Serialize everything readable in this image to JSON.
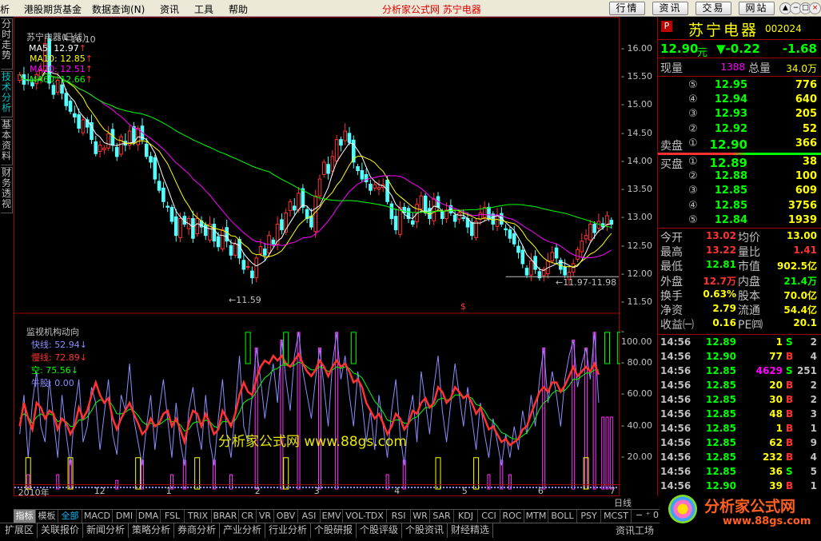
{
  "menu": {
    "items": [
      "析",
      "港股期货基金",
      "数据查询(N)",
      "资讯",
      "工具",
      "帮助"
    ],
    "title": "分析家公式网  苏宁电器",
    "buttons": [
      "行情",
      "资讯",
      "交易",
      "网站"
    ],
    "window_controls": [
      "▲",
      "−",
      "□",
      "×"
    ]
  },
  "side_tabs": [
    "分时走势",
    "技术分析",
    "基本资料",
    "财务透视"
  ],
  "price_panel": {
    "title": "苏宁电器(日线)",
    "mas": [
      {
        "label": "MA5: 12.97",
        "color": "#ffffff"
      },
      {
        "label": "MA10: 12.85",
        "color": "#ffff00"
      },
      {
        "label": "MA20: 12.51",
        "color": "#ff00ff"
      },
      {
        "label": "MA60: 12.66",
        "color": "#00ff00"
      }
    ],
    "ylim": [
      11.35,
      16.25
    ],
    "ticks": [
      {
        "value": 16.0,
        "label": "16.00"
      },
      {
        "value": 15.5,
        "label": "15.50"
      },
      {
        "value": 15.0,
        "label": "15.00"
      },
      {
        "value": 14.5,
        "label": "14.50"
      },
      {
        "value": 14.0,
        "label": "14.00"
      },
      {
        "value": 13.5,
        "label": "13.50"
      },
      {
        "value": 13.0,
        "label": "13.00"
      },
      {
        "value": 12.5,
        "label": "12.50"
      },
      {
        "value": 12.0,
        "label": "12.00"
      },
      {
        "value": 11.5,
        "label": "11.50"
      }
    ],
    "high_label": "16.10",
    "low_label": "11.59",
    "range_label": "11.97-11.98",
    "marker": "$",
    "up_color": "#ff3232",
    "down_color": "#54ffff"
  },
  "indicator_panel": {
    "title": "监视机构动向",
    "lines": [
      {
        "label": "快线: 52.94↓",
        "color": "#8c8cff"
      },
      {
        "label": "慢线: 72.89↓",
        "color": "#ff3232"
      },
      {
        "label": "空: 75.56↓",
        "color": "#00ff00"
      },
      {
        "label": "牛股: 0.00",
        "color": "#8c8cff"
      }
    ],
    "ylim": [
      0,
      105
    ],
    "ticks": [
      {
        "value": 100,
        "label": "100.00"
      },
      {
        "value": 80,
        "label": "80.00"
      },
      {
        "value": 60,
        "label": "60.00"
      },
      {
        "value": 40,
        "label": "40.00"
      },
      {
        "value": 20,
        "label": "20.00"
      }
    ],
    "watermark": "分析家公式网 www.88gs.com"
  },
  "xaxis": {
    "labels": [
      {
        "day": 0,
        "text": "2010年"
      },
      {
        "day": 18,
        "text": "12"
      },
      {
        "day": 35,
        "text": "1"
      },
      {
        "day": 56,
        "text": "2"
      },
      {
        "day": 70,
        "text": "3"
      },
      {
        "day": 89,
        "text": "4"
      },
      {
        "day": 105,
        "text": "5"
      },
      {
        "day": 123,
        "text": "6"
      },
      {
        "day": 140,
        "text": "7"
      }
    ],
    "period": "日线"
  },
  "chart_data": {
    "type": "candlestick",
    "ohlc_close": [
      15.55,
      15.38,
      15.45,
      15.35,
      15.55,
      15.62,
      16.1,
      15.4,
      15.2,
      15.45,
      15.22,
      15.0,
      14.9,
      14.8,
      14.6,
      14.75,
      14.62,
      14.4,
      14.15,
      14.3,
      14.25,
      14.5,
      14.3,
      14.1,
      14.45,
      14.3,
      14.55,
      14.35,
      14.6,
      14.4,
      14.1,
      14.0,
      13.7,
      13.5,
      13.3,
      13.2,
      12.95,
      12.7,
      13.0,
      12.9,
      13.0,
      12.65,
      13.0,
      12.85,
      12.7,
      12.9,
      12.6,
      12.5,
      12.8,
      12.6,
      12.35,
      12.55,
      12.3,
      12.1,
      12.15,
      11.95,
      12.3,
      12.5,
      12.35,
      12.7,
      12.55,
      12.9,
      12.8,
      13.1,
      13.3,
      13.15,
      13.45,
      13.2,
      13.0,
      12.85,
      13.4,
      13.7,
      14.0,
      13.8,
      14.1,
      14.4,
      14.3,
      14.55,
      14.35,
      14.0,
      13.85,
      13.7,
      13.65,
      13.5,
      13.6,
      13.55,
      13.6,
      13.3,
      13.0,
      12.8,
      13.2,
      13.1,
      13.0,
      12.9,
      13.25,
      13.4,
      13.1,
      13.0,
      13.35,
      13.2,
      13.0,
      13.15,
      13.1,
      12.95,
      13.1,
      13.0,
      12.85,
      12.7,
      12.95,
      13.1,
      13.2,
      13.0,
      12.9,
      13.05,
      12.9,
      12.8,
      12.65,
      12.55,
      12.4,
      12.2,
      12.0,
      12.25,
      12.1,
      11.95,
      12.1,
      12.25,
      12.4,
      12.3,
      12.1,
      12.0,
      12.05,
      12.2,
      12.45,
      12.6,
      12.7,
      12.9,
      12.75,
      12.95,
      12.85,
      13.05,
      12.9
    ],
    "kdj": {
      "fast": [
        35,
        60,
        20,
        55,
        75,
        40,
        30,
        70,
        45,
        20,
        60,
        35,
        15,
        50,
        70,
        30,
        40,
        65,
        55,
        25,
        48,
        70,
        35,
        22,
        60,
        50,
        80,
        45,
        30,
        15,
        40,
        60,
        25,
        50,
        70,
        45,
        20,
        55,
        30,
        15,
        50,
        65,
        40,
        25,
        60,
        30,
        15,
        45,
        70,
        35,
        20,
        50,
        85,
        40,
        30,
        60,
        90,
        70,
        45,
        65,
        80,
        55,
        95,
        70,
        50,
        85,
        100,
        75,
        60,
        45,
        70,
        90,
        65,
        40,
        80,
        100,
        70,
        85,
        60,
        40,
        75,
        55,
        30,
        50,
        25,
        60,
        40,
        20,
        50,
        70,
        35,
        15,
        45,
        60,
        30,
        75,
        55,
        35,
        65,
        85,
        50,
        30,
        55,
        80,
        60,
        40,
        65,
        45,
        25,
        55,
        35,
        20,
        45,
        30,
        15,
        35,
        20,
        40,
        25,
        50,
        35,
        60,
        40,
        70,
        90,
        55,
        75,
        60,
        40,
        70,
        85,
        95,
        65,
        80,
        90,
        70,
        100,
        55
      ],
      "slow": [
        40,
        55,
        45,
        38,
        55,
        52,
        45,
        50,
        48,
        38,
        45,
        42,
        35,
        40,
        52,
        45,
        50,
        60,
        68,
        60,
        55,
        58,
        45,
        38,
        45,
        50,
        55,
        48,
        42,
        35,
        38,
        45,
        40,
        42,
        48,
        50,
        40,
        45,
        38,
        30,
        42,
        50,
        48,
        40,
        48,
        42,
        35,
        38,
        50,
        45,
        40,
        48,
        60,
        68,
        62,
        60,
        70,
        78,
        82,
        80,
        85,
        82,
        85,
        80,
        78,
        82,
        86,
        80,
        75,
        72,
        76,
        82,
        78,
        72,
        78,
        82,
        78,
        80,
        75,
        68,
        70,
        65,
        55,
        50,
        45,
        48,
        42,
        35,
        40,
        48,
        45,
        38,
        42,
        50,
        48,
        55,
        58,
        52,
        55,
        65,
        62,
        55,
        58,
        65,
        62,
        58,
        60,
        55,
        48,
        52,
        45,
        38,
        40,
        35,
        30,
        32,
        28,
        30,
        32,
        38,
        40,
        48,
        55,
        62,
        65,
        62,
        68,
        68,
        62,
        66,
        72,
        78,
        72,
        75,
        78,
        75,
        80,
        73
      ],
      "mid": [
        45,
        48,
        46,
        42,
        46,
        48,
        46,
        48,
        47,
        43,
        44,
        43,
        40,
        40,
        44,
        44,
        46,
        50,
        55,
        57,
        56,
        57,
        53,
        48,
        48,
        49,
        51,
        50,
        47,
        43,
        41,
        42,
        41,
        41,
        43,
        45,
        43,
        43,
        41,
        37,
        38,
        42,
        43,
        42,
        44,
        43,
        40,
        39,
        43,
        43,
        42,
        44,
        49,
        55,
        57,
        58,
        62,
        67,
        71,
        73,
        76,
        77,
        79,
        79,
        78,
        79,
        81,
        80,
        78,
        76,
        76,
        78,
        77,
        75,
        76,
        78,
        77,
        78,
        77,
        74,
        73,
        71,
        66,
        61,
        56,
        53,
        49,
        44,
        43,
        44,
        44,
        42,
        42,
        45,
        46,
        49,
        52,
        52,
        53,
        57,
        58,
        57,
        57,
        60,
        60,
        59,
        59,
        58,
        54,
        53,
        50,
        45,
        43,
        40,
        36,
        35,
        33,
        32,
        32,
        34,
        36,
        40,
        45,
        51,
        55,
        57,
        61,
        63,
        62,
        63,
        66,
        70,
        70,
        72,
        74,
        74,
        76,
        76
      ],
      "markers_green": [
        54,
        63,
        79,
        139,
        142
      ],
      "markers_yellow": [
        2,
        12,
        28,
        42,
        63,
        99,
        108,
        134
      ]
    }
  },
  "stock": {
    "badge": "P",
    "name": "苏宁电器",
    "code": "002024",
    "price": "12.90",
    "unit": "元",
    "change": "▼-0.22",
    "pct": "-1.68"
  },
  "volume_row": {
    "l1": "现量",
    "v1": "1388",
    "l2": "总量",
    "v2": "34.0万"
  },
  "asks": [
    {
      "lvl": "⑤",
      "price": "12.95",
      "vol": "776"
    },
    {
      "lvl": "④",
      "price": "12.94",
      "vol": "640"
    },
    {
      "lvl": "③",
      "price": "12.93",
      "vol": "205"
    },
    {
      "lvl": "②",
      "price": "12.92",
      "vol": "52"
    },
    {
      "lvl": "①",
      "price": "12.90",
      "vol": "366",
      "label": "卖盘"
    }
  ],
  "bids": [
    {
      "lvl": "①",
      "price": "12.89",
      "vol": "38",
      "label": "买盘"
    },
    {
      "lvl": "②",
      "price": "12.88",
      "vol": "100"
    },
    {
      "lvl": "③",
      "price": "12.85",
      "vol": "609"
    },
    {
      "lvl": "④",
      "price": "12.85",
      "vol": "3756"
    },
    {
      "lvl": "⑤",
      "price": "12.84",
      "vol": "1939"
    }
  ],
  "stats": [
    {
      "l1": "今开",
      "v1": "13.02",
      "c1": "#ff3232",
      "l2": "均价",
      "v2": "13.00",
      "c2": "#ffff00"
    },
    {
      "l1": "最高",
      "v1": "13.22",
      "c1": "#ff3232",
      "l2": "量比",
      "v2": "1.41",
      "c2": "#ff3232"
    },
    {
      "l1": "最低",
      "v1": "12.81",
      "c1": "#00ff00",
      "l2": "市值",
      "v2": "902.5亿",
      "c2": "#ffff00"
    },
    {
      "l1": "外盘",
      "v1": "12.7万",
      "c1": "#ff3232",
      "l2": "内盘",
      "v2": "21.4万",
      "c2": "#00ff00"
    },
    {
      "l1": "换手",
      "v1": "0.63%",
      "c1": "#ffff00",
      "l2": "股本",
      "v2": "70.0亿",
      "c2": "#ffff00"
    },
    {
      "l1": "净资",
      "v1": "2.79",
      "c1": "#ffff00",
      "l2": "流通",
      "v2": "54.4亿",
      "c2": "#ffff00"
    },
    {
      "l1": "收益㈠",
      "v1": "0.16",
      "c1": "#ffff00",
      "l2": "PE㈣",
      "v2": "20.1",
      "c2": "#ffff00"
    }
  ],
  "ticks_list": [
    {
      "time": "14:56",
      "price": "12.89",
      "vol": "1",
      "side": "S",
      "n": "2"
    },
    {
      "time": "14:56",
      "price": "12.90",
      "vol": "77",
      "side": "B",
      "n": "4"
    },
    {
      "time": "14:56",
      "price": "12.85",
      "vol": "4629",
      "side": "S",
      "n": "251"
    },
    {
      "time": "14:56",
      "price": "12.85",
      "vol": "20",
      "side": "B",
      "n": "2"
    },
    {
      "time": "14:56",
      "price": "12.85",
      "vol": "30",
      "side": "B",
      "n": "2"
    },
    {
      "time": "14:56",
      "price": "12.85",
      "vol": "48",
      "side": "B",
      "n": "3"
    },
    {
      "time": "14:56",
      "price": "12.85",
      "vol": "1",
      "side": "B",
      "n": "1"
    },
    {
      "time": "14:56",
      "price": "12.85",
      "vol": "62",
      "side": "B",
      "n": "9"
    },
    {
      "time": "14:56",
      "price": "12.85",
      "vol": "232",
      "side": "B",
      "n": "4"
    },
    {
      "time": "14:56",
      "price": "12.85",
      "vol": "36",
      "side": "S",
      "n": "5"
    },
    {
      "time": "14:56",
      "price": "12.90",
      "vol": "39",
      "side": "B",
      "n": "1"
    }
  ],
  "indicator_tabs": [
    "指标",
    "模板",
    "全部",
    "MACD",
    "DMI",
    "DMA",
    "FSL",
    "TRIX",
    "BRAR",
    "CR",
    "VR",
    "OBV",
    "ASI",
    "EMV",
    "VOL-TDX",
    "RSI",
    "WR",
    "SAR",
    "KDJ",
    "CCI",
    "ROC",
    "MTM",
    "BOLL",
    "PSY",
    "MCST"
  ],
  "bottom_tabs": [
    "扩展区",
    "关联报价",
    "新闻分析",
    "策略分析",
    "券商分析",
    "产业分析",
    "行业分析",
    "个股研报",
    "个股评级",
    "个股资讯",
    "财经精选"
  ],
  "bottom_right": "资讯工场",
  "logo": {
    "text": "分析家公式网",
    "url": "www.88gs.com"
  }
}
